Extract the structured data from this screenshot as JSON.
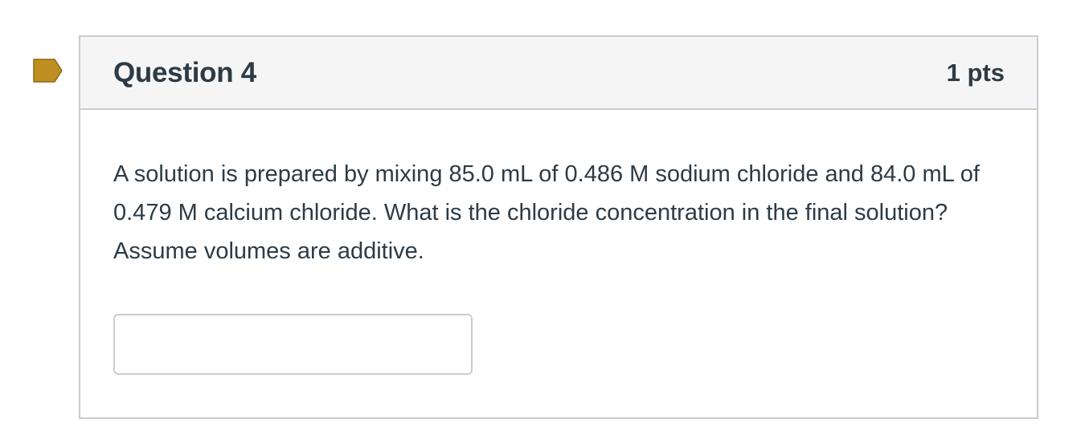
{
  "question": {
    "flag_icon": "bookmark-flag-icon",
    "flag_color": "#bf8f21",
    "title": "Question 4",
    "points": "1 pts",
    "text": "A solution is prepared by mixing 85.0 mL of 0.486 M sodium chloride and 84.0 mL of 0.479 M calcium chloride. What is the chloride concentration in the final solution? Assume volumes are additive.",
    "answer": {
      "value": "",
      "placeholder": ""
    }
  },
  "colors": {
    "text": "#2d3b45",
    "border": "#c7cdd1",
    "header_bg": "#f5f5f5"
  }
}
